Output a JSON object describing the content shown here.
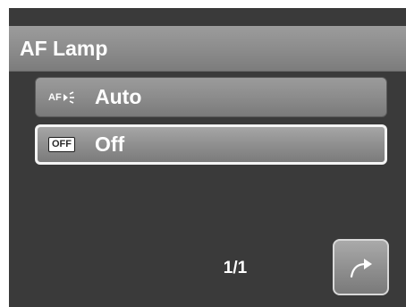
{
  "header": {
    "title": "AF Lamp"
  },
  "options": [
    {
      "icon_text": "AF",
      "icon": "af-lamp-icon",
      "label": "Auto",
      "selected": false
    },
    {
      "icon_text": "OFF",
      "icon": "off-icon",
      "label": "Off",
      "selected": true
    }
  ],
  "footer": {
    "page": "1/1",
    "back_icon": "return-arrow-icon"
  },
  "colors": {
    "background": "#3a3a3a",
    "selection_border": "#f4f4f4",
    "text": "#ffffff"
  }
}
